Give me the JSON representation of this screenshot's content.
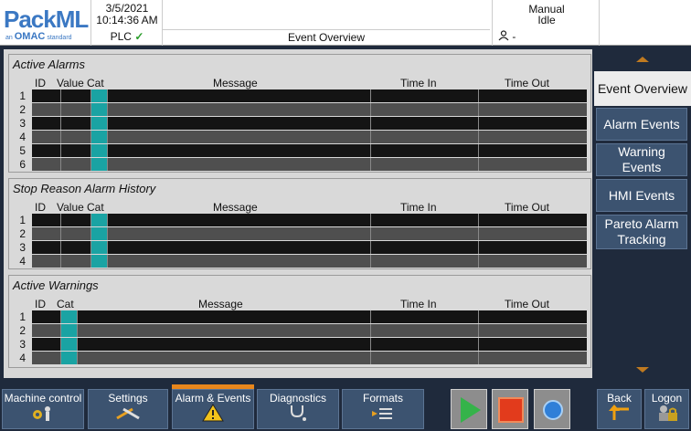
{
  "header": {
    "brand": "PackML",
    "brand_sub_prefix": "an",
    "brand_sub_org": "OMAC",
    "brand_sub_suffix": "standard",
    "date": "3/5/2021",
    "time": "10:14:36 AM",
    "plc_label": "PLC",
    "plc_status": "✓",
    "screen_title": "Event Overview",
    "mode": "Manual",
    "state": "Idle",
    "user": "-"
  },
  "panels": {
    "active_alarms": {
      "title": "Active Alarms",
      "columns": {
        "id": "ID",
        "value": "Value",
        "cat": "Cat",
        "message": "Message",
        "time_in": "Time In",
        "time_out": "Time Out"
      },
      "rows": [
        "1",
        "2",
        "3",
        "4",
        "5",
        "6"
      ]
    },
    "stop_reason": {
      "title": "Stop Reason Alarm History",
      "columns": {
        "id": "ID",
        "value": "Value",
        "cat": "Cat",
        "message": "Message",
        "time_in": "Time In",
        "time_out": "Time Out"
      },
      "rows": [
        "1",
        "2",
        "3",
        "4"
      ]
    },
    "active_warnings": {
      "title": "Active Warnings",
      "columns": {
        "id": "ID",
        "cat": "Cat",
        "message": "Message",
        "time_in": "Time In",
        "time_out": "Time Out"
      },
      "rows": [
        "1",
        "2",
        "3",
        "4"
      ]
    }
  },
  "rightnav": {
    "items": [
      {
        "label": "Event Overview",
        "active": true
      },
      {
        "label": "Alarm Events"
      },
      {
        "label": "Warning Events"
      },
      {
        "label": "HMI Events"
      },
      {
        "label": "Pareto Alarm Tracking"
      }
    ]
  },
  "bottombar": {
    "tabs": [
      {
        "label": "Machine control",
        "icon": "gears-person-icon"
      },
      {
        "label": "Settings",
        "icon": "wrench-icon"
      },
      {
        "label": "Alarm & Events",
        "icon": "warning-icon",
        "active": true
      },
      {
        "label": "Diagnostics",
        "icon": "stethoscope-icon"
      },
      {
        "label": "Formats",
        "icon": "formats-icon"
      }
    ],
    "back_label": "Back",
    "logon_label": "Logon"
  },
  "colors": {
    "accent": "#e8861c",
    "nav_bg": "#3c5370",
    "category_teal": "#1aa3a3",
    "start_green": "#35b34a",
    "stop_red": "#e23b1c",
    "reset_blue": "#2f7fd8"
  }
}
